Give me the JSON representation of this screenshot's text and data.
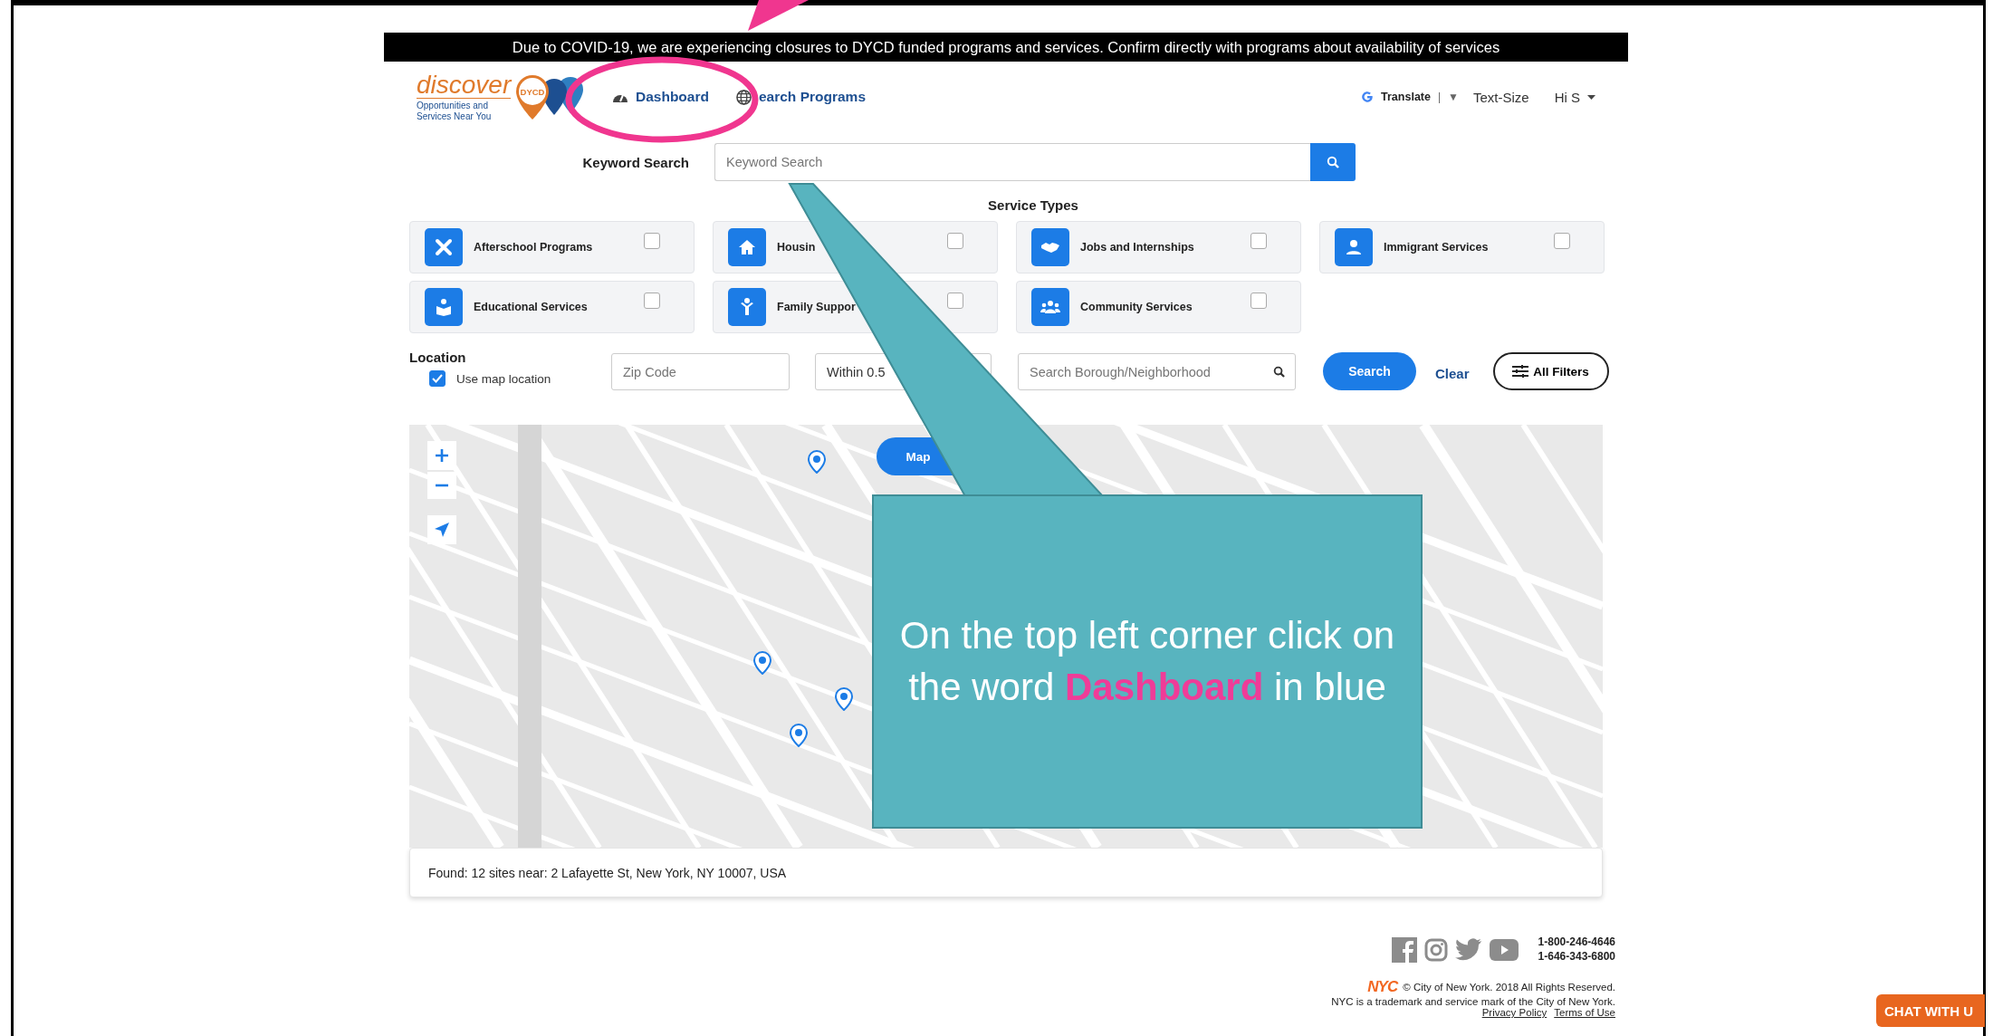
{
  "banner": "Due to COVID-19, we are experiencing closures to DYCD funded programs and services. Confirm directly with programs about availability of services",
  "logo": {
    "word": "discover",
    "badge": "DYCD",
    "tagline": "Opportunities and Services Near You"
  },
  "nav": [
    {
      "label": "Dashboard",
      "kind": "gauge"
    },
    {
      "label": "earch Programs",
      "kind": "globe"
    }
  ],
  "header_right": {
    "translate": "Translate",
    "separator": "|",
    "dropdown": "▼",
    "text_size": "Text-Size",
    "user": "Hi S"
  },
  "keyword": {
    "label": "Keyword Search",
    "placeholder": "Keyword Search"
  },
  "service_types": {
    "title": "Service Types",
    "items": [
      {
        "label": "Afterschool Programs",
        "kind": "tools",
        "checked": false
      },
      {
        "label": "Housin",
        "kind": "house",
        "checked": false
      },
      {
        "label": "Jobs and Internships",
        "kind": "handshake",
        "checked": false
      },
      {
        "label": "Immigrant Services",
        "kind": "person",
        "checked": false
      },
      {
        "label": "Educational Services",
        "kind": "reader",
        "checked": false
      },
      {
        "label": "Family Suppor",
        "kind": "figure",
        "checked": false
      },
      {
        "label": "Community Services",
        "kind": "group",
        "checked": false
      }
    ]
  },
  "location": {
    "title": "Location",
    "use_map": {
      "label": "Use map location",
      "checked": true
    },
    "zip_placeholder": "Zip Code",
    "radius": "Within 0.5",
    "borough_placeholder": "Search Borough/Neighborhood"
  },
  "buttons": {
    "search": "Search",
    "clear": "Clear",
    "all_filters": "All Filters"
  },
  "map": {
    "toggle": "Map"
  },
  "found": "Found: 12 sites near: 2 Lafayette St, New York, NY 10007, USA",
  "footer": {
    "phones": [
      "1-800-246-4646",
      "1-646-343-6800"
    ],
    "nyc": "NYC",
    "copyright": "© City of New York. 2018 All Rights Reserved.",
    "trademark": "NYC is a trademark and service mark of the City of New York.",
    "links": [
      "Privacy Policy",
      "Terms of Use"
    ]
  },
  "chat": "CHAT WITH U",
  "annotation": {
    "text": "On the top left corner click on the word **Dashboard** in blue"
  }
}
